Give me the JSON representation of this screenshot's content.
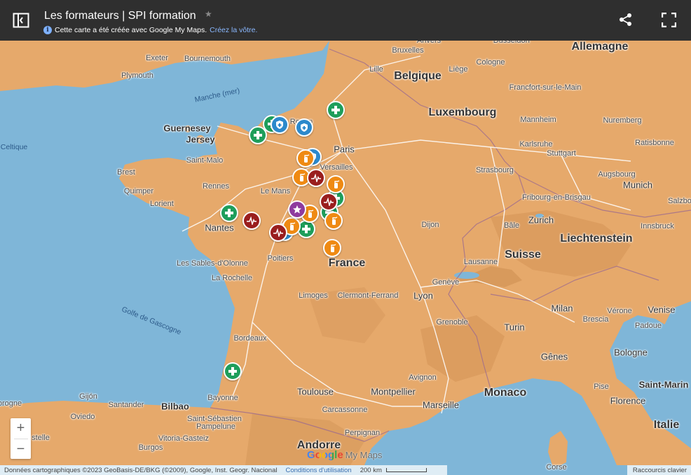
{
  "header": {
    "title": "Les formateurs | SPI formation",
    "subtitle": "Cette carte a été créée avec Google My Maps.",
    "subtitle_link": "Créez la vôtre."
  },
  "colors": {
    "header_bg": "#2f2f2f",
    "sea": "#7fb6d8",
    "land": "#e6a96b",
    "marker_green": "#1e9e5b",
    "marker_blue": "#2c89cc",
    "marker_orange": "#ef8a13",
    "marker_darkred": "#9a1e1e",
    "marker_purple": "#8e3a9e"
  },
  "map": {
    "labels": {
      "allemagne": "Allemagne",
      "belgique": "Belgique",
      "luxembourg": "Luxembourg",
      "france": "France",
      "suisse": "Suisse",
      "liechtenstein": "Liechtenstein",
      "monaco": "Monaco",
      "andorre": "Andorre",
      "italie": "Italie",
      "saint_marin": "Saint-Marin",
      "guernesey": "Guernesey",
      "jersey": "Jersey",
      "manche": "Manche (mer)",
      "golfe": "Golfe de Gascogne",
      "celtique": "Celtique",
      "bruxelles": "Bruxelles",
      "anvers": "Anvers",
      "dusseldorf": "Düsseldorf",
      "cologne": "Cologne",
      "liege": "Liège",
      "lille": "Lille",
      "francfort": "Francfort-sur-le-Main",
      "nuremberg": "Nuremberg",
      "mannheim": "Mannheim",
      "karlsruhe": "Karlsruhe",
      "stuttgart": "Stuttgart",
      "ratisbonne": "Ratisbonne",
      "augsbourg": "Augsbourg",
      "munich": "Munich",
      "salzbourg": "Salzbo",
      "strasbourg": "Strasbourg",
      "fribourg": "Fribourg-en-Brisgau",
      "zurich": "Zurich",
      "bale": "Bâle",
      "innsbruck": "Innsbruck",
      "exeter": "Exeter",
      "bournemouth": "Bournemouth",
      "plymouth": "Plymouth",
      "rouen": "Rouen",
      "paris": "Paris",
      "versailles": "Versailles",
      "brest": "Brest",
      "quimper": "Quimper",
      "lorient": "Lorient",
      "saint_malo": "Saint-Malo",
      "rennes": "Rennes",
      "le_mans": "Le Mans",
      "nantes": "Nantes",
      "sables": "Les Sables-d'Olonne",
      "poitiers": "Poitiers",
      "la_rochelle": "La Rochelle",
      "limoges": "Limoges",
      "dijon": "Dijon",
      "lausanne": "Lausanne",
      "geneve": "Genève",
      "lyon": "Lyon",
      "clermont": "Clermont-Ferrand",
      "grenoble": "Grenoble",
      "milan": "Milan",
      "verone": "Vérone",
      "venise": "Venise",
      "brescia": "Brescia",
      "padoue": "Padoue",
      "turin": "Turin",
      "bologne": "Bologne",
      "genes": "Gênes",
      "florence": "Florence",
      "pise": "Pise",
      "bordeaux": "Bordeaux",
      "toulouse": "Toulouse",
      "montpellier": "Montpellier",
      "avignon": "Avignon",
      "marseille": "Marseille",
      "carcassonne": "Carcassonne",
      "perpignan": "Perpignan",
      "bayonne": "Bayonne",
      "bilbao": "Bilbao",
      "santander": "Santander",
      "gijon": "Gijón",
      "oviedo": "Oviedo",
      "saint_sebastien": "Saint-Sébastien",
      "pampelune": "Pampelune",
      "vitoria": "Vitoria-Gasteiz",
      "burgos": "Burgos",
      "castille": "stelle",
      "corogne": "orogne",
      "corse": "Corse"
    }
  },
  "controls": {
    "zoom_in": "+",
    "zoom_out": "−"
  },
  "watermark": {
    "google": "Google",
    "mymaps": "My Maps"
  },
  "footer": {
    "data": "Données cartographiques ©2023 GeoBasis-DE/BKG (©2009), Google, Inst. Geogr. Nacional",
    "terms": "Conditions d'utilisation",
    "scale": "200 km",
    "shortcuts": "Raccourcis clavier"
  }
}
